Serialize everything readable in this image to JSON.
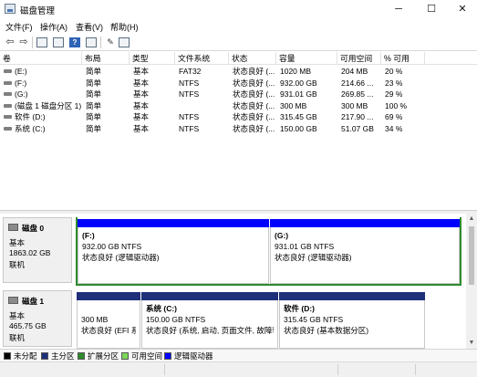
{
  "window": {
    "title": "磁盘管理",
    "minimize_glyph": "─",
    "maximize_glyph": "☐",
    "close_glyph": "✕"
  },
  "menu": [
    "文件(F)",
    "操作(A)",
    "查看(V)",
    "帮助(H)"
  ],
  "toolbar_icons": [
    "back-arrow-icon",
    "forward-arrow-icon",
    "properties-icon",
    "help-icon",
    "refresh-icon",
    "settings-icon",
    "console-icon"
  ],
  "volume_table": {
    "columns": [
      "卷",
      "布局",
      "类型",
      "文件系统",
      "状态",
      "容量",
      "可用空间",
      "% 可用"
    ],
    "rows": [
      [
        "(E:)",
        "简单",
        "基本",
        "FAT32",
        "状态良好 (...",
        "1020 MB",
        "204 MB",
        "20 %"
      ],
      [
        "(F:)",
        "简单",
        "基本",
        "NTFS",
        "状态良好 (...",
        "932.00 GB",
        "214.66 ...",
        "23 %"
      ],
      [
        "(G:)",
        "简单",
        "基本",
        "NTFS",
        "状态良好 (...",
        "931.01 GB",
        "269.85 ...",
        "29 %"
      ],
      [
        "(磁盘 1 磁盘分区 1)",
        "简单",
        "基本",
        "",
        "状态良好 (...",
        "300 MB",
        "300 MB",
        "100 %"
      ],
      [
        "软件 (D:)",
        "简单",
        "基本",
        "NTFS",
        "状态良好 (...",
        "315.45 GB",
        "217.90 ...",
        "69 %"
      ],
      [
        "系统 (C:)",
        "简单",
        "基本",
        "NTFS",
        "状态良好 (...",
        "150.00 GB",
        "51.07 GB",
        "34 %"
      ]
    ]
  },
  "disks": [
    {
      "name": "磁盘 0",
      "type": "基本",
      "size": "1863.02 GB",
      "state": "联机",
      "partitions": [
        {
          "label": "(F:)",
          "size_fs": "932.00 GB NTFS",
          "status": "状态良好 (逻辑驱动器)",
          "bar_color": "#0000ff"
        },
        {
          "label": "(G:)",
          "size_fs": "931.01 GB NTFS",
          "status": "状态良好 (逻辑驱动器)",
          "bar_color": "#0000ff"
        }
      ]
    },
    {
      "name": "磁盘 1",
      "type": "基本",
      "size": "465.75 GB",
      "state": "联机",
      "partitions": [
        {
          "label": "",
          "size_fs": "300 MB",
          "status": "状态良好 (EFI 系",
          "bar_color": "#1f2f7a"
        },
        {
          "label": "系统 (C:)",
          "size_fs": "150.00 GB NTFS",
          "status": "状态良好 (系统, 启动, 页面文件, 故障转",
          "bar_color": "#1f2f7a"
        },
        {
          "label": "软件 (D:)",
          "size_fs": "315.45 GB NTFS",
          "status": "状态良好 (基本数据分区)",
          "bar_color": "#1f2f7a"
        }
      ]
    }
  ],
  "legend": [
    {
      "label": "未分配",
      "color": "#000000"
    },
    {
      "label": "主分区",
      "color": "#1f2f7a"
    },
    {
      "label": "扩展分区",
      "color": "#2e8b2e"
    },
    {
      "label": "可用空间",
      "color": "#7dd85a"
    },
    {
      "label": "逻辑驱动器",
      "color": "#0000ff"
    }
  ],
  "colors": {
    "extended_partition_border": "#2e8b2e",
    "logical_drive": "#0000ff",
    "primary_partition": "#1f2f7a"
  }
}
